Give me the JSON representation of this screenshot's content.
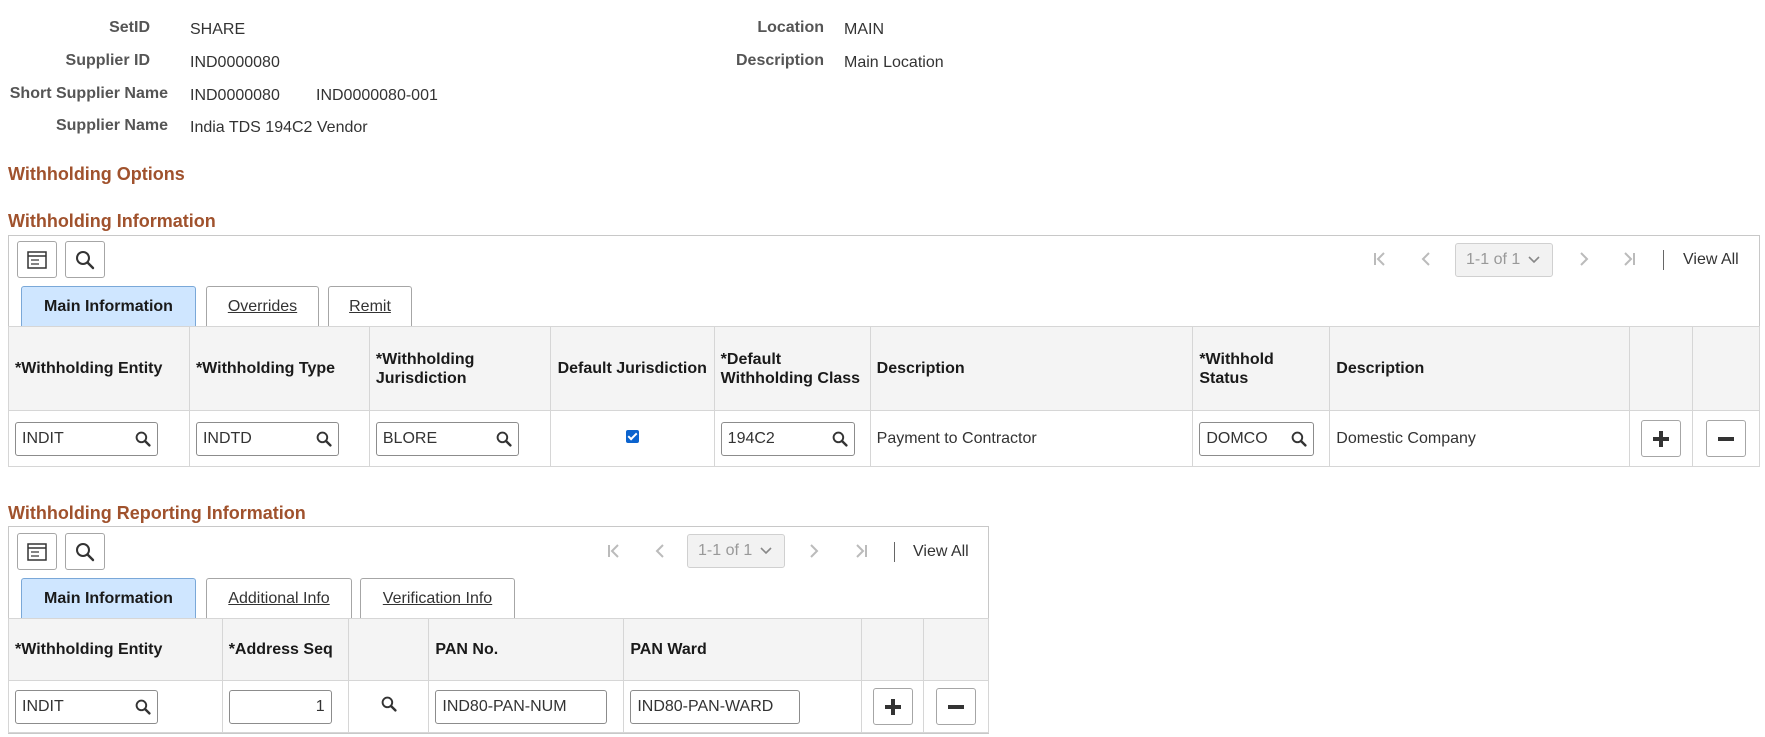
{
  "header": {
    "setid_label": "SetID",
    "setid_value": "SHARE",
    "supplier_id_label": "Supplier ID",
    "supplier_id_value": "IND0000080",
    "short_name_label": "Short Supplier Name",
    "short_name_value": "IND0000080",
    "short_name_suffix": "IND0000080-001",
    "supplier_name_label": "Supplier Name",
    "supplier_name_value": "India TDS 194C2 Vendor",
    "location_label": "Location",
    "location_value": "MAIN",
    "description_label": "Description",
    "description_value": "Main Location"
  },
  "withholding_options": {
    "title": "Withholding Options"
  },
  "withholding_info": {
    "title": "Withholding Information",
    "pager": "1-1 of 1",
    "view_all": "View All",
    "tabs": [
      {
        "label": "Main Information",
        "active": true
      },
      {
        "label": "Overrides",
        "active": false
      },
      {
        "label": "Remit",
        "active": false
      }
    ],
    "columns": [
      "*Withholding Entity",
      "*Withholding Type",
      "*Withholding Jurisdiction",
      "Default Jurisdiction",
      "*Default Withholding Class",
      "Description",
      "*Withhold Status",
      "Description"
    ],
    "row": {
      "entity": "INDIT",
      "type": "INDTD",
      "jurisdiction": "BLORE",
      "default_jurisdiction": true,
      "class": "194C2",
      "class_description": "Payment to Contractor",
      "status": "DOMCO",
      "status_description": "Domestic Company"
    }
  },
  "reporting_info": {
    "title": "Withholding Reporting Information",
    "pager": "1-1 of 1",
    "view_all": "View All",
    "tabs": [
      {
        "label": "Main Information",
        "active": true
      },
      {
        "label": "Additional Info",
        "active": false
      },
      {
        "label": "Verification Info",
        "active": false
      }
    ],
    "columns": [
      "*Withholding Entity",
      "*Address Seq",
      "PAN No.",
      "PAN Ward"
    ],
    "row": {
      "entity": "INDIT",
      "address_seq": "1",
      "pan_no": "IND80-PAN-NUM",
      "pan_ward": "IND80-PAN-WARD"
    }
  },
  "icons": {
    "grid_personalize": "grid-settings-icon",
    "search": "search-icon",
    "first": "first-page-icon",
    "prev": "previous-icon",
    "next": "next-icon",
    "last": "last-page-icon",
    "add": "plus-icon",
    "delete": "minus-icon"
  },
  "colors": {
    "section_title": "#a0522d",
    "active_tab": "#cfe6ff",
    "checkbox": "#0b63ce"
  }
}
